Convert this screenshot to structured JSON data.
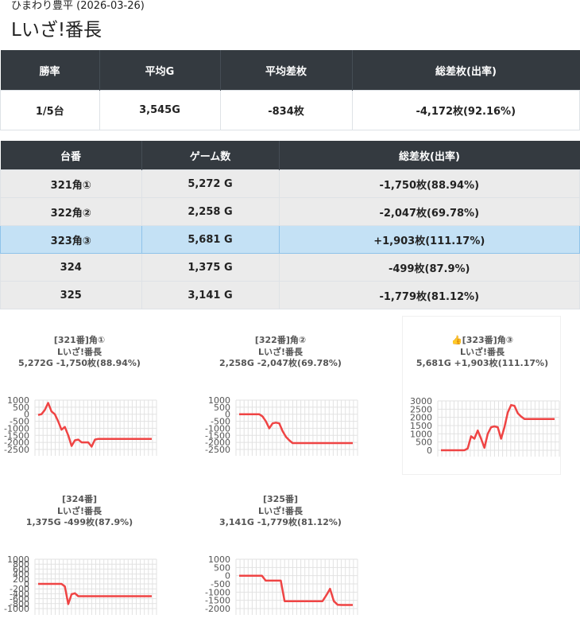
{
  "header": {
    "subtitle": "ひまわり豊平 (2026-03-26)",
    "title": "Lいざ!番長"
  },
  "summary": {
    "headers": [
      "勝率",
      "平均G",
      "平均差枚",
      "総差枚(出率)"
    ],
    "row": [
      "1/5台",
      "3,545G",
      "-834枚",
      "-4,172枚(92.16%)"
    ]
  },
  "units": {
    "headers": [
      "台番",
      "ゲーム数",
      "総差枚(出率)"
    ],
    "rows": [
      {
        "no": "321角①",
        "games": "5,272 G",
        "diff": "-1,750枚(88.94%)",
        "highlight": false
      },
      {
        "no": "322角②",
        "games": "2,258 G",
        "diff": "-2,047枚(69.78%)",
        "highlight": false
      },
      {
        "no": "323角③",
        "games": "5,681 G",
        "diff": "+1,903枚(111.17%)",
        "highlight": true
      },
      {
        "no": "324",
        "games": "1,375 G",
        "diff": "-499枚(87.9%)",
        "highlight": false
      },
      {
        "no": "325",
        "games": "3,141 G",
        "diff": "-1,779枚(81.12%)",
        "highlight": false
      }
    ]
  },
  "colors": {
    "line": "#ef4444",
    "header_bg": "#343a40",
    "highlight_row": "#c4e1f5"
  },
  "chart_data": [
    {
      "type": "line",
      "title_lines": [
        "[321番]角①",
        "Lいざ!番長",
        "5,272G -1,750枚(88.94%)"
      ],
      "ylim": [
        -2500,
        1000
      ],
      "yticks": [
        1000,
        500,
        0,
        -500,
        -1000,
        -1500,
        -2000,
        -2500
      ],
      "values": [
        -50,
        0,
        300,
        800,
        200,
        0,
        -500,
        -1100,
        -900,
        -1500,
        -2250,
        -1850,
        -1800,
        -2000,
        -2000,
        -2000,
        -2300,
        -1800,
        -1750,
        -1750,
        -1750,
        -1750,
        -1750,
        -1750,
        -1750,
        -1750,
        -1750,
        -1750,
        -1750,
        -1750,
        -1750,
        -1750,
        -1750,
        -1750,
        -1750
      ]
    },
    {
      "type": "line",
      "title_lines": [
        "[322番]角②",
        "Lいざ!番長",
        "2,258G -2,047枚(69.78%)"
      ],
      "ylim": [
        -2500,
        1000
      ],
      "yticks": [
        1000,
        500,
        0,
        -500,
        -1000,
        -1500,
        -2000,
        -2500
      ],
      "values": [
        0,
        0,
        0,
        0,
        0,
        0,
        0,
        -150,
        -500,
        -1000,
        -650,
        -600,
        -650,
        -1200,
        -1600,
        -1850,
        -2050,
        -2050,
        -2050,
        -2050,
        -2050,
        -2050,
        -2050,
        -2050,
        -2050,
        -2050,
        -2050,
        -2050,
        -2050,
        -2050,
        -2050,
        -2050,
        -2050,
        -2050,
        -2050
      ]
    },
    {
      "type": "line",
      "title_lines": [
        "👍[323番]角③",
        "Lいざ!番長",
        "5,681G +1,903枚(111.17%)"
      ],
      "ylim": [
        0,
        3000
      ],
      "yticks": [
        3000,
        2500,
        2000,
        1500,
        1000,
        500,
        0
      ],
      "values": [
        0,
        0,
        0,
        0,
        0,
        0,
        0,
        0,
        100,
        850,
        700,
        1200,
        700,
        150,
        1000,
        1400,
        1450,
        1400,
        700,
        1400,
        2300,
        2750,
        2700,
        2250,
        2050,
        1900,
        1900,
        1900,
        1900,
        1900,
        1900,
        1900,
        1900,
        1900,
        1900
      ]
    },
    {
      "type": "line",
      "title_lines": [
        "[324番]",
        "Lいざ!番長",
        "1,375G -499枚(87.9%)"
      ],
      "ylim": [
        -1000,
        1000
      ],
      "yticks": [
        1000,
        800,
        600,
        400,
        200,
        0,
        -200,
        -400,
        -600,
        -800,
        -1000
      ],
      "values": [
        0,
        0,
        0,
        0,
        0,
        0,
        0,
        0,
        -100,
        -820,
        -420,
        -380,
        -500,
        -500,
        -500,
        -500,
        -500,
        -500,
        -500,
        -500,
        -500,
        -500,
        -500,
        -500,
        -500,
        -500,
        -500,
        -500,
        -500,
        -500,
        -500,
        -500,
        -500,
        -500,
        -500
      ]
    },
    {
      "type": "line",
      "title_lines": [
        "[325番]",
        "Lいざ!番長",
        "3,141G -1,779枚(81.12%)"
      ],
      "ylim": [
        -2000,
        1000
      ],
      "yticks": [
        1000,
        500,
        0,
        -500,
        -1000,
        -1500,
        -2000
      ],
      "values": [
        0,
        0,
        0,
        0,
        0,
        0,
        0,
        -300,
        -300,
        -300,
        -300,
        -300,
        -1550,
        -1550,
        -1550,
        -1550,
        -1550,
        -1550,
        -1550,
        -1550,
        -1550,
        -1550,
        -1550,
        -1200,
        -800,
        -1550,
        -1770,
        -1780,
        -1780,
        -1780,
        -1780
      ]
    }
  ]
}
